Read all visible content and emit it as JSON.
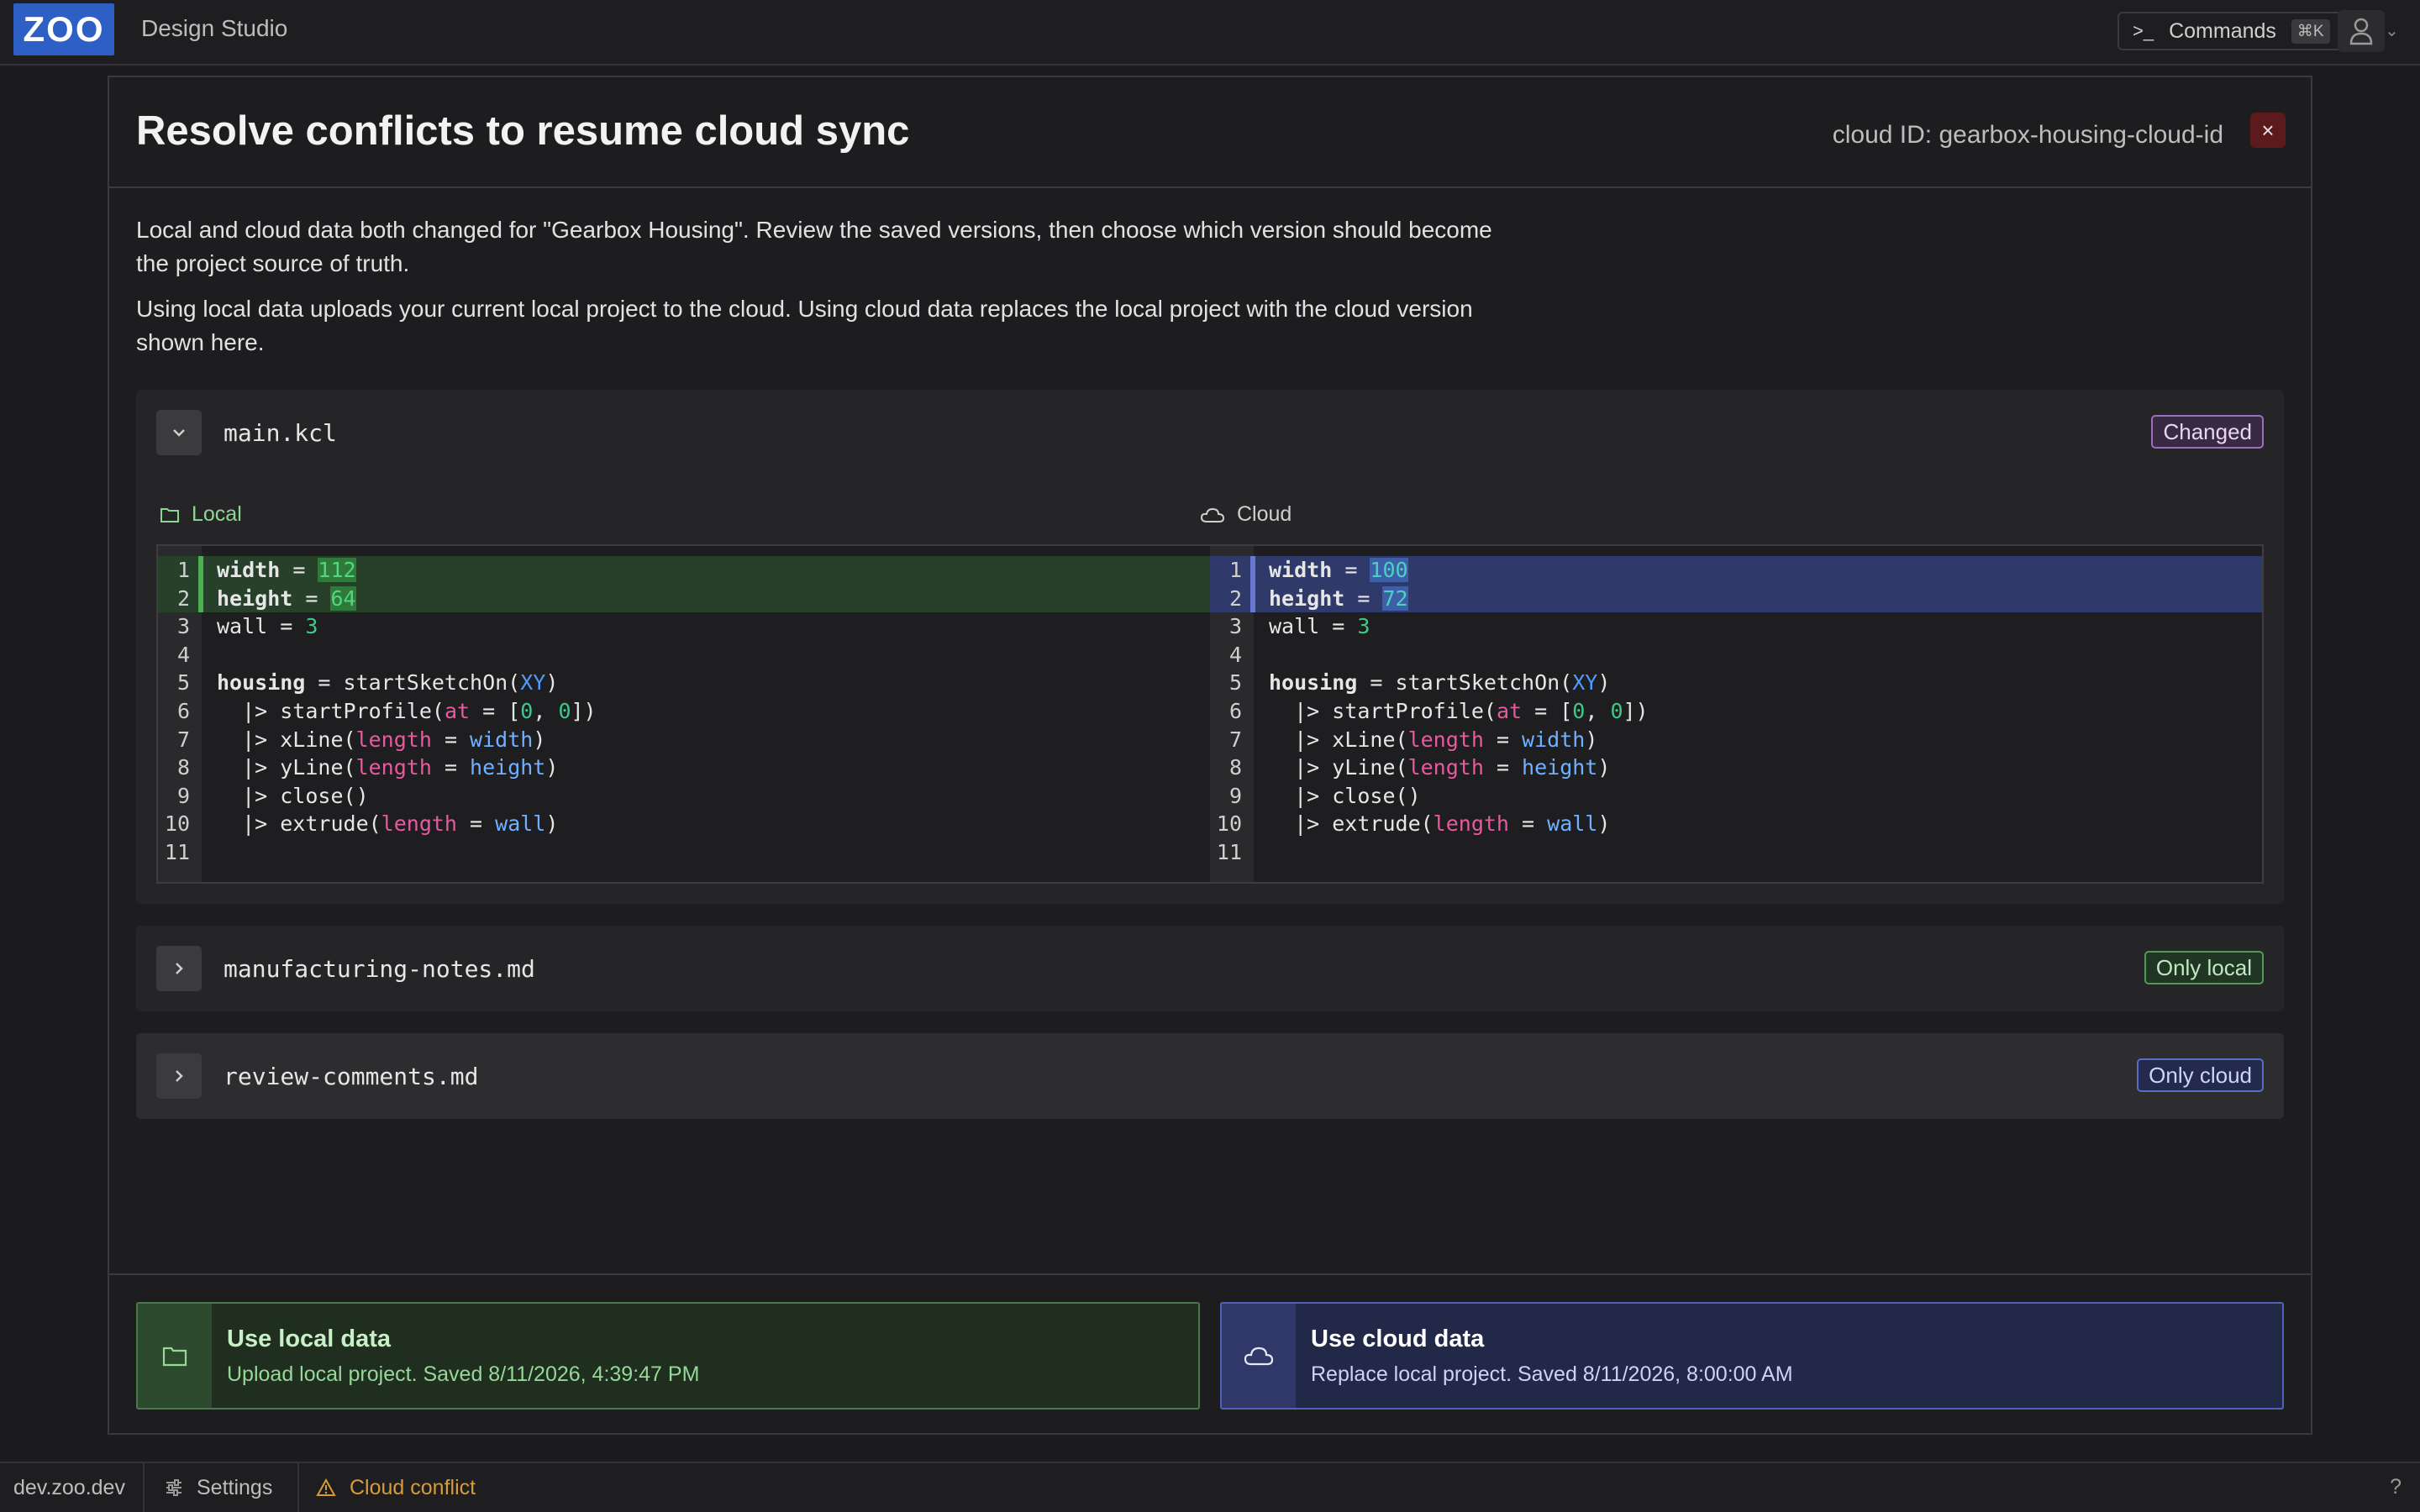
{
  "app": {
    "logo": "ZOO",
    "title": "Design Studio"
  },
  "header": {
    "commands_label": "Commands",
    "commands_shortcut": "⌘K"
  },
  "modal": {
    "title": "Resolve conflicts to resume cloud sync",
    "cloud_id": "cloud ID: gearbox-housing-cloud-id",
    "close": "×",
    "desc1": "Local and cloud data both changed for \"Gearbox Housing\". Review the saved versions, then choose which version should become the project source of truth.",
    "desc2": "Using local data uploads your current local project to the cloud. Using cloud data replaces the local project with the cloud version shown here."
  },
  "files": [
    {
      "name": "main.kcl",
      "badge": "Changed",
      "expanded": true
    },
    {
      "name": "manufacturing-notes.md",
      "badge": "Only local",
      "expanded": false
    },
    {
      "name": "review-comments.md",
      "badge": "Only cloud",
      "expanded": false
    }
  ],
  "diff": {
    "local_label": "Local",
    "cloud_label": "Cloud",
    "local_values": {
      "width": "112",
      "height": "64"
    },
    "cloud_values": {
      "width": "100",
      "height": "72"
    },
    "line_numbers": [
      "1",
      "2",
      "3",
      "4",
      "5",
      "6",
      "7",
      "8",
      "9",
      "10",
      "11"
    ]
  },
  "actions": {
    "local": {
      "title": "Use local data",
      "subtitle": "Upload local project. Saved 8/11/2026, 4:39:47 PM"
    },
    "cloud": {
      "title": "Use cloud data",
      "subtitle": "Replace local project. Saved 8/11/2026, 8:00:00 AM"
    }
  },
  "statusbar": {
    "host": "dev.zoo.dev",
    "settings": "Settings",
    "conflict": "Cloud conflict",
    "help": "?"
  },
  "colors": {
    "accent_blue": "#2d5fc4",
    "local_green": "#4caf50",
    "cloud_indigo": "#5c6cc5",
    "danger": "#5c1a1c",
    "warning": "#d89b3a"
  }
}
